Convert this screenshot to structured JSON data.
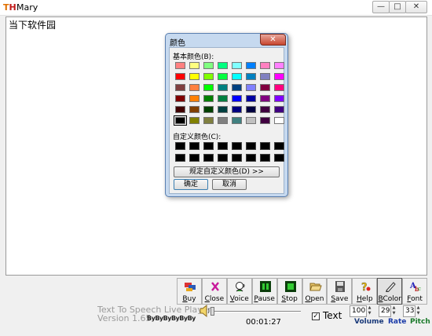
{
  "window": {
    "title": "Mary",
    "icon_text": "TH"
  },
  "content": {
    "text": "当下软件园"
  },
  "color_dialog": {
    "title": "颜色",
    "basic_label": "基本颜色(B):",
    "custom_label": "自定义颜色(C):",
    "define_button": "规定自定义颜色(D) >>",
    "ok_button": "确定",
    "cancel_button": "取消",
    "basic_colors": [
      "#ff8080",
      "#ffff80",
      "#80ff80",
      "#00ff80",
      "#80ffff",
      "#0080ff",
      "#ff80c0",
      "#ff80ff",
      "#ff0000",
      "#ffff00",
      "#80ff00",
      "#00ff40",
      "#00ffff",
      "#0080c0",
      "#8080c0",
      "#ff00ff",
      "#804040",
      "#ff8040",
      "#00ff00",
      "#008080",
      "#004080",
      "#8080ff",
      "#800040",
      "#ff0080",
      "#800000",
      "#ff8000",
      "#008000",
      "#008040",
      "#0000ff",
      "#0000a0",
      "#800080",
      "#8000ff",
      "#400000",
      "#804000",
      "#004000",
      "#004040",
      "#000080",
      "#000040",
      "#400040",
      "#400080",
      "#000000",
      "#808000",
      "#808040",
      "#808080",
      "#408080",
      "#c0c0c0",
      "#400040",
      "#ffffff"
    ],
    "selected_index": 40
  },
  "toolbar": {
    "buttons": [
      {
        "label": "Buy",
        "key": "B"
      },
      {
        "label": "Close",
        "key": "C"
      },
      {
        "label": "Voice",
        "key": "V"
      },
      {
        "label": "Pause",
        "key": "P"
      },
      {
        "label": "Stop",
        "key": "S"
      },
      {
        "label": "Open",
        "key": "O"
      },
      {
        "label": "Save",
        "key": "S"
      },
      {
        "label": "Help",
        "key": "H"
      },
      {
        "label": "BColor",
        "key": "B"
      },
      {
        "label": "Font",
        "key": "F"
      }
    ]
  },
  "player": {
    "product_name": "Text To Speech Live Player",
    "version": "Version 1.65",
    "brand_mark": "ByByByByByBy",
    "elapsed": "00:01:27",
    "text_checkbox_label": "Text",
    "text_checked": true,
    "volume_value": "100",
    "volume_label": "Volume",
    "rate_value": "29",
    "rate_label": "Rate",
    "pitch_value": "33",
    "pitch_label": "Pitch"
  }
}
